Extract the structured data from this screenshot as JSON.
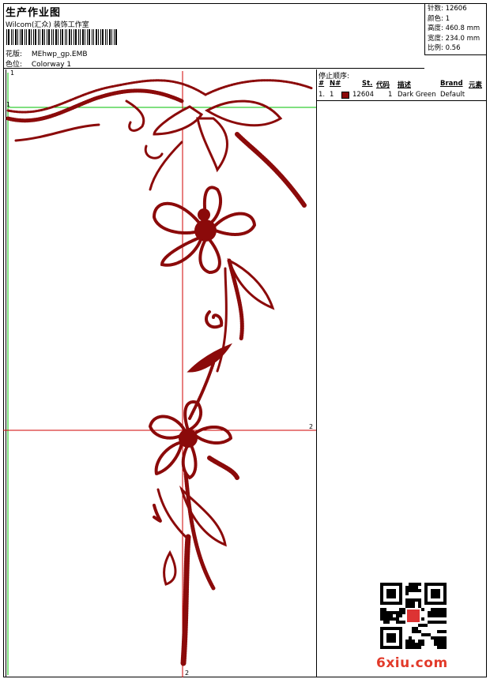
{
  "header": {
    "title": "生产作业图",
    "company": "Wilcom(汇众) 装饰工作室",
    "design_label": "花版:",
    "design_file": "MEhwp_gp.EMB",
    "colorway_label": "色位:",
    "colorway": "Colorway 1"
  },
  "stats": {
    "stitches": "针数: 12606",
    "colors": "颜色: 1",
    "height": "高度: 460.8 mm",
    "width": "宽度: 234.0 mm",
    "scale": "比例: 0.56"
  },
  "stop_sequence": {
    "heading": "停止顺序:",
    "columns": [
      "#",
      "N#",
      "St.",
      "代码",
      "描述",
      "Brand",
      "元素"
    ],
    "rows": [
      {
        "index": "1.",
        "needle": "1",
        "stitches": "12604",
        "code": "1",
        "description": "Dark Green",
        "brand": "Default",
        "swatch": "#8b0a0a"
      }
    ]
  },
  "canvas": {
    "marker_top_left": "1",
    "marker_left": "1",
    "marker_right": "2",
    "marker_bottom": "2",
    "thread_color": "#8b0a0a",
    "guide_green": "#00c000",
    "guide_red": "#d00000"
  },
  "watermark": "6xiu.com"
}
